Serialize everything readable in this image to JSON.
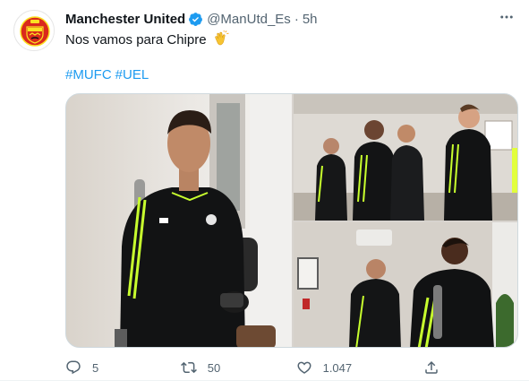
{
  "tweet": {
    "author_name": "Manchester United",
    "handle": "@ManUtd_Es",
    "separator": "·",
    "time": "5h",
    "text": "Nos vamos para Chipre",
    "hashtags": [
      "#MUFC",
      "#UEL"
    ],
    "media_count": 3,
    "icons": {
      "avatar": "manchester-united-crest",
      "verified": "verified-badge-icon",
      "more": "more-icon",
      "emoji": "clapping-hands-emoji"
    },
    "actions": {
      "reply_count": "5",
      "retweet_count": "50",
      "like_count": "1.047"
    }
  },
  "colors": {
    "accent": "#1d9bf0",
    "secondary_text": "#536471",
    "primary_text": "#0f1419",
    "crest_red": "#da291c",
    "crest_yellow": "#fbe122"
  }
}
